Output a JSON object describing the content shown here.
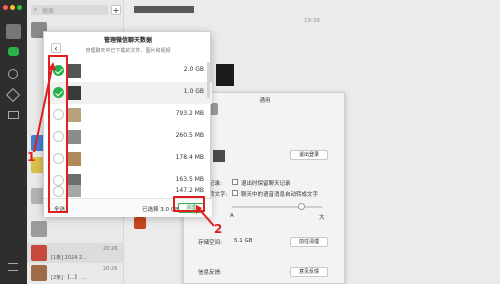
{
  "chat_list": {
    "search_placeholder": "搜索",
    "add_label": "+",
    "items": [
      {
        "time": "",
        "preview": ""
      },
      {
        "time": "",
        "preview": ""
      },
      {
        "time": "",
        "preview": ""
      },
      {
        "time": "20:26",
        "preview": "[1条] 2024 2..."
      },
      {
        "time": "20:26",
        "preview": "[2条] 【…】 ..."
      }
    ]
  },
  "main": {
    "time_label": "19:38"
  },
  "modal": {
    "title": "管理微信聊天数据",
    "subtitle": "管理聊天中已下载的文件、图片和视频",
    "items": [
      {
        "size": "2.0 GB",
        "checked": true
      },
      {
        "size": "1.0 GB",
        "checked": true
      },
      {
        "size": "793.2 MB",
        "checked": false
      },
      {
        "size": "260.5 MB",
        "checked": false
      },
      {
        "size": "178.4 MB",
        "checked": false
      },
      {
        "size": "163.5 MB",
        "checked": false
      },
      {
        "size": "147.2 MB",
        "checked": false
      }
    ],
    "select_all_label": "全选",
    "selected_label": "已选择 3.0 GB",
    "clean_button": "清理"
  },
  "settings": {
    "title": "通用",
    "logout_button": "退出登录",
    "logout_clear_label": "退出时保留聊天记录",
    "voice_prefix": "语音转文字:",
    "voice_option_label": "聊天中的语音消息自动转成文字",
    "font_small_label": "A",
    "font_large_label": "大",
    "chat_record_label": "聊天记录:",
    "storage_label": "存储空间:",
    "storage_value": "5.1 GB",
    "manage_button": "前往清理",
    "feedback_label": "信息反馈:",
    "feedback_button": "意见反馈"
  },
  "annotations": {
    "label_one": "1",
    "label_two": "2",
    "color": "#e02020"
  }
}
